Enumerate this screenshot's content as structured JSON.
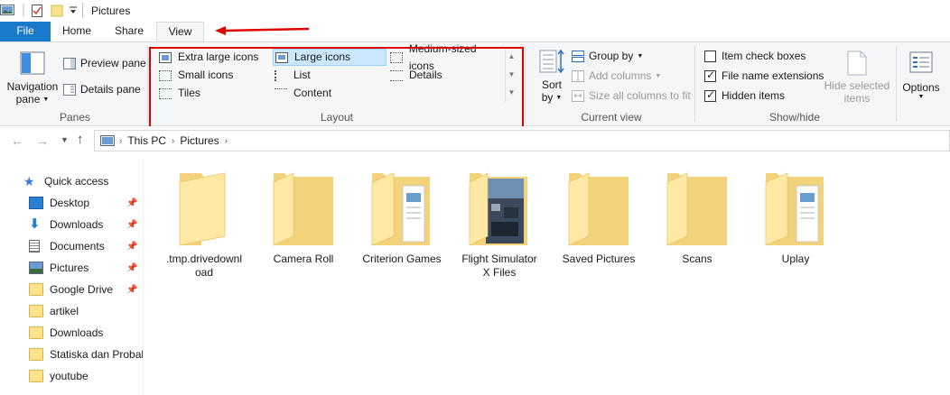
{
  "window": {
    "title": "Pictures"
  },
  "tabs": {
    "file": "File",
    "home": "Home",
    "share": "Share",
    "view": "View"
  },
  "panes": {
    "navigation_pane_line1": "Navigation",
    "navigation_pane_line2": "pane",
    "preview_pane": "Preview pane",
    "details_pane": "Details pane",
    "group_label": "Panes"
  },
  "layout": {
    "items": {
      "extra_large": "Extra large icons",
      "large": "Large icons",
      "medium": "Medium-sized icons",
      "small": "Small icons",
      "list": "List",
      "details": "Details",
      "tiles": "Tiles",
      "content": "Content"
    },
    "selected": "Large icons",
    "group_label": "Layout"
  },
  "current_view": {
    "sort_line1": "Sort",
    "sort_line2": "by",
    "group_by": "Group by",
    "add_columns": "Add columns",
    "size_all_columns": "Size all columns to fit",
    "group_label": "Current view"
  },
  "show_hide": {
    "item_check_boxes": "Item check boxes",
    "file_name_extensions": "File name extensions",
    "hidden_items": "Hidden items",
    "item_check_boxes_checked": false,
    "file_name_extensions_checked": true,
    "hidden_items_checked": true,
    "hide_selected_line1": "Hide selected",
    "hide_selected_line2": "items",
    "group_label": "Show/hide"
  },
  "options": {
    "label": "Options"
  },
  "address": {
    "crumbs": [
      "This PC",
      "Pictures"
    ]
  },
  "nav_pane": {
    "quick_access": "Quick access",
    "items": [
      "Desktop",
      "Downloads",
      "Documents",
      "Pictures",
      "Google Drive",
      "artikel",
      "Downloads",
      "Statiska dan Probab",
      "youtube"
    ]
  },
  "files": [
    {
      "name_line1": ".tmp.drivedownl",
      "name_line2": "oad"
    },
    {
      "name_line1": "Camera Roll",
      "name_line2": ""
    },
    {
      "name_line1": "Criterion Games",
      "name_line2": ""
    },
    {
      "name_line1": "Flight Simulator",
      "name_line2": "X Files"
    },
    {
      "name_line1": "Saved Pictures",
      "name_line2": ""
    },
    {
      "name_line1": "Scans",
      "name_line2": ""
    },
    {
      "name_line1": "Uplay",
      "name_line2": ""
    }
  ],
  "colors": {
    "file_tab": "#1979ca",
    "highlight": "#e10000",
    "selected_bg": "#cce8ff",
    "folder": "#ffe38a"
  }
}
